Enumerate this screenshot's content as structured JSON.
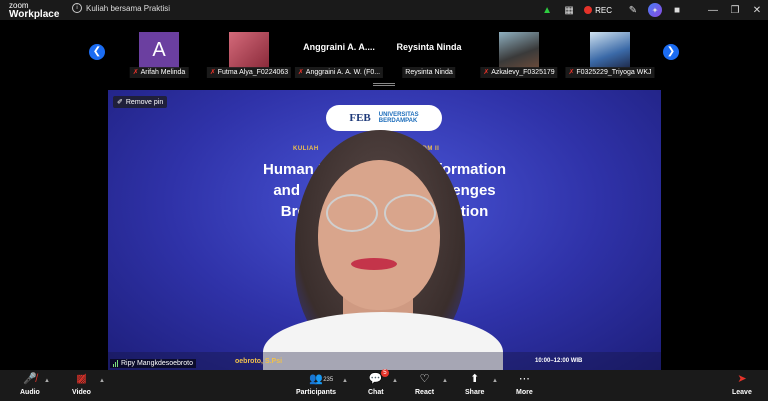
{
  "app": {
    "brand_line1": "zoom",
    "brand_line2": "Workplace",
    "meeting_title": "Kuliah bersama Praktisi",
    "rec_label": "REC"
  },
  "strip": {
    "participants": [
      {
        "label": "Arifah Melinda",
        "initial": "A",
        "tile_color": "#6b3fa0"
      },
      {
        "label": "Futma Alya_F0224063",
        "tile_color": "#c24a5a"
      },
      {
        "label": "Anggraini A. A. W. (F0...",
        "big_name": "Anggraini A. A...."
      },
      {
        "label": "Reysinta Ninda",
        "big_name": "Reysinta Ninda"
      },
      {
        "label": "Azkalevy_F0325179",
        "tile_color": "#4a5a5a"
      },
      {
        "label": "F0325229_Triyoga WKJ",
        "tile_color": "#3b6aa8"
      }
    ]
  },
  "main": {
    "pin_label": "Remove pin",
    "logo_text": "FEB",
    "logo_u_line1": "UNIVERSITAS",
    "logo_u_line2": "BERDAMPAK",
    "subtitle": "KULIAH",
    "subtitle_right": "JEMEN SDM II",
    "title_line1_left": "Human R",
    "title_line1_right": "formation",
    "title_line2_left": "and Ad",
    "title_line2_right": "allenges",
    "title_line3_left": "Broug",
    "title_line3_right": "zation",
    "lower_name": "oebroto, S.Psi",
    "lower_time": "10:00–12:00 WIB",
    "speaker_tag": "Ripy Mangkdesoebroto"
  },
  "toolbar": {
    "audio": "Audio",
    "video": "Video",
    "participants": "Participants",
    "participants_count": "235",
    "chat": "Chat",
    "chat_badge": "5",
    "react": "React",
    "share": "Share",
    "more": "More",
    "leave": "Leave"
  },
  "colors": {
    "accent": "#1b6cf2",
    "muted": "#e5332a",
    "slide_bg": "#2f32a8",
    "toolbar_bg": "#1a1a1a"
  }
}
